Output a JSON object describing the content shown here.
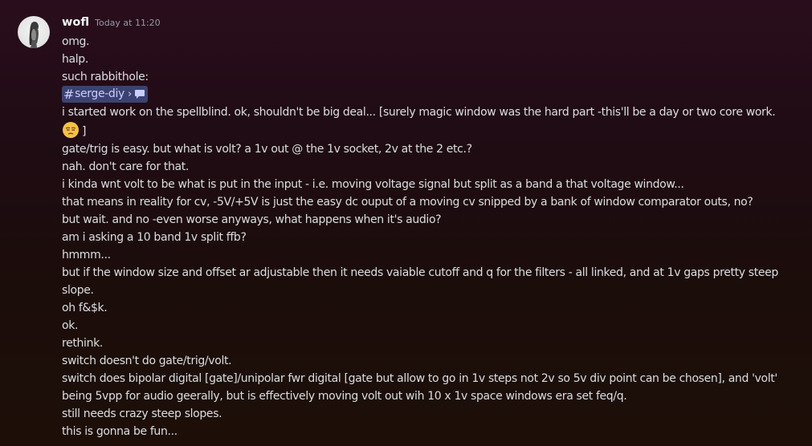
{
  "message": {
    "author": "wofl",
    "timestamp": "Today at 11:20",
    "lines_before_mention": [
      "omg.",
      "halp.",
      "such rabbithole:"
    ],
    "channel_mention": {
      "hash": "#",
      "name": "serge-diy",
      "chevron": "›",
      "icon": "chat-bubble-icon"
    },
    "line_spellblind": "i started work on the spellblind. ok, shouldn't be big deal... [surely magic window was the hard part -this'll be a day or two core work.",
    "emoji_line_suffix": "]",
    "emoji_icon": "unamused-face-emoji",
    "lines_after": [
      "gate/trig is easy. but what is volt? a 1v out @ the 1v socket, 2v at the 2 etc.?",
      "nah. don't care for that.",
      "i kinda wnt volt to be what is put in the input - i.e. moving voltage signal but split as a band a that voltage window...",
      "that means in reality for cv, -5V/+5V is just the easy dc ouput of a moving cv snipped by a bank of window comparator outs, no?",
      "but wait. and no -even worse anyways, what happens when it's audio?",
      "am i asking a 10 band 1v split ffb?",
      "hmmm...",
      "but if the window size and offset ar adjustable then it needs vaiable cutoff and q for the filters - all linked, and at 1v gaps pretty steep slope.",
      "oh f&$k.",
      "ok.",
      "rethink.",
      "switch doesn't do gate/trig/volt.",
      "switch does bipolar digital [gate]/unipolar fwr digital [gate but allow to go in 1v steps not 2v so 5v div point can be chosen], and 'volt'",
      "being 5vpp for audio geerally, but is effectively moving volt out wih 10 x 1v space windows era set feq/q.",
      "still needs crazy steep slopes.",
      "this is gonna be fun..."
    ]
  }
}
